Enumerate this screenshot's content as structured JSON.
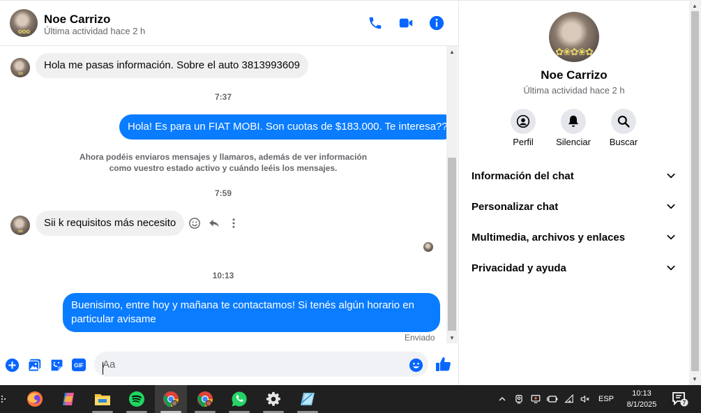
{
  "header": {
    "name": "Noe Carrizo",
    "status": "Última actividad hace 2 h"
  },
  "messages": {
    "m1": "Hola me pasas información. Sobre el auto 3813993609",
    "t1": "7:37",
    "m2": "Hola! Es para un FIAT MOBI. Son cuotas de $183.000. Te interesa??",
    "notice": "Ahora podéis enviaros mensajes y llamaros, además de ver información como vuestro estado activo y cuándo leéis los mensajes.",
    "t2": "7:59",
    "m3": "Sii k requisitos más necesito",
    "t3": "10:13",
    "m4": "Buenisimo, entre hoy y mañana te contactamos! Si tenés algún horario en particular avisame",
    "sent": "Enviado"
  },
  "composer": {
    "placeholder": "Aa",
    "gif": "GIF"
  },
  "info": {
    "name": "Noe Carrizo",
    "status": "Última actividad hace 2 h",
    "actions": [
      "Perfil",
      "Silenciar",
      "Buscar"
    ],
    "sections": [
      "Información del chat",
      "Personalizar chat",
      "Multimedia, archivos y enlaces",
      "Privacidad y ayuda"
    ]
  },
  "taskbar": {
    "lang": "ESP",
    "time": "10:13",
    "date": "8/1/2025",
    "notif_count": "7"
  },
  "colors": {
    "accent": "#0a7cff",
    "icon_blue": "#0866ff",
    "bubble_in": "#f0f0f0"
  }
}
